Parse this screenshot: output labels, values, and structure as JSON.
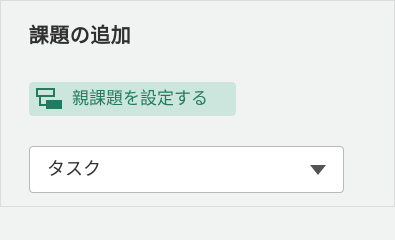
{
  "section": {
    "title": "課題の追加"
  },
  "parent_issue_button": {
    "label": "親課題を設定する",
    "icon": "parent-issue-icon"
  },
  "issue_type_select": {
    "selected": "タスク",
    "icon": "chevron-down-icon"
  },
  "colors": {
    "accent": "#237b5f",
    "accent_bg": "#cde6dd",
    "panel_bg": "#f1f2f2"
  }
}
